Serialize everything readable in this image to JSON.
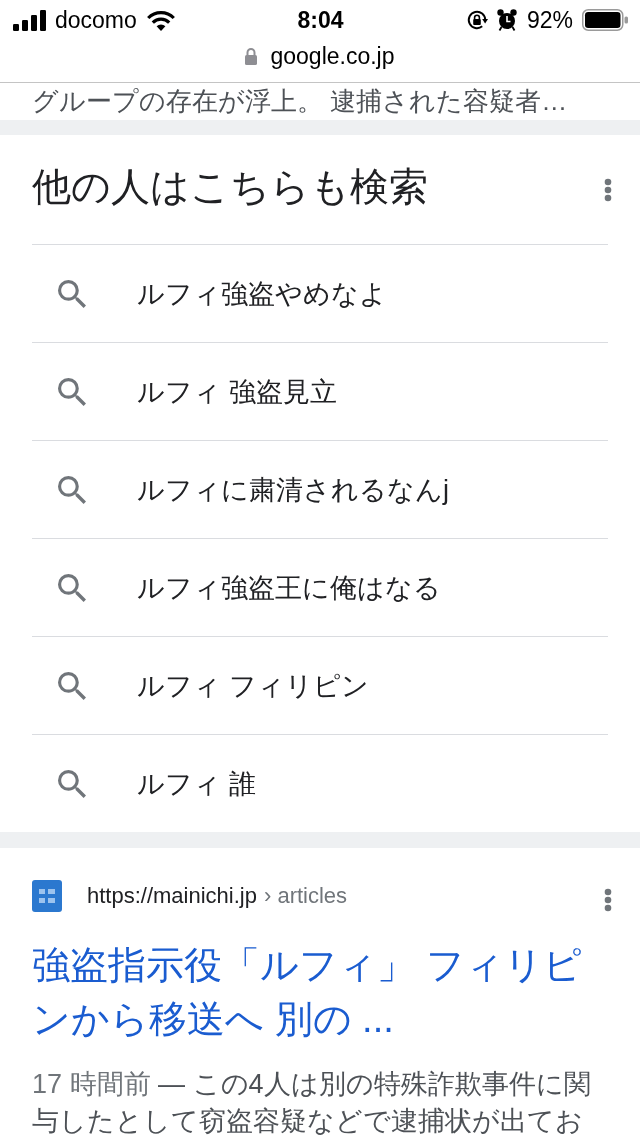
{
  "status_bar": {
    "carrier": "docomo",
    "time": "8:04",
    "battery": "92%"
  },
  "browser": {
    "url": "google.co.jp"
  },
  "previous_snippet": {
    "text": "グループの存在が浮上。 逮捕された容疑者…"
  },
  "related_searches": {
    "title": "他の人はこちらも検索",
    "items": [
      {
        "text": "ルフィ強盗やめなよ"
      },
      {
        "text": "ルフィ 強盗見立"
      },
      {
        "text": "ルフィに粛清されるなんj"
      },
      {
        "text": "ルフィ強盗王に俺はなる"
      },
      {
        "text": "ルフィ フィリピン"
      },
      {
        "text": "ルフィ 誰"
      }
    ]
  },
  "result": {
    "site_url": "https://mainichi.jp",
    "breadcrumb": "› articles",
    "title": "強盗指示役「ルフィ」 フィリピンから移送へ 別の ...",
    "date": "17 時間前",
    "snippet": "— この4人は別の特殊詐欺事件に関与したとして窃盗容疑などで逮捕状が出てお"
  }
}
